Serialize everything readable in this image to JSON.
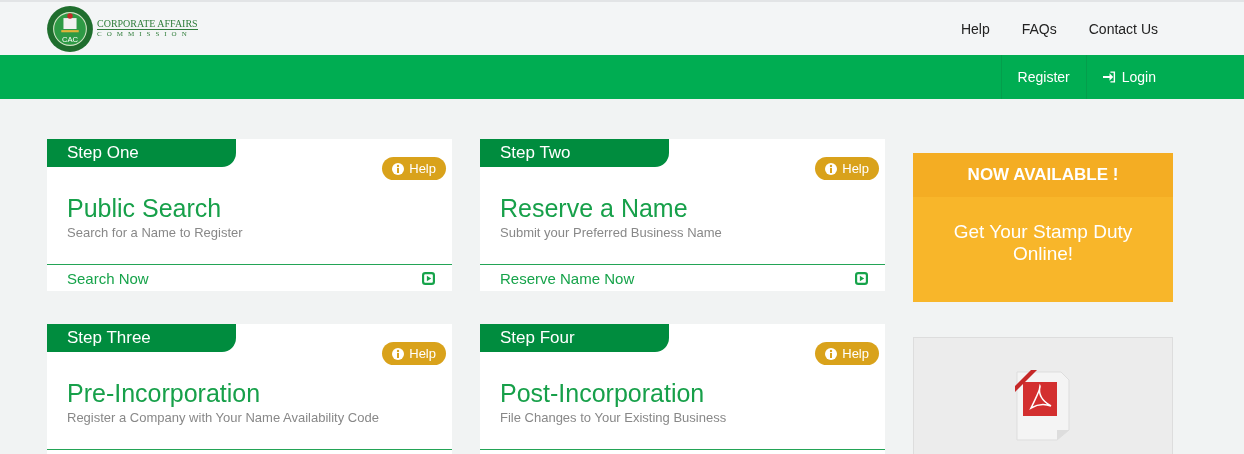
{
  "logo": {
    "seal_text": "CAC",
    "line_1": "CORPORATE AFFAIRS",
    "line_2": "COMMISSION"
  },
  "top_nav": [
    "Help",
    "FAQs",
    "Contact Us"
  ],
  "account_nav": [
    {
      "label": "Register",
      "kind": "plain"
    },
    {
      "label": "Login",
      "kind": "login"
    }
  ],
  "steps": [
    {
      "step": "Step One",
      "help": "Help",
      "title": "Public Search",
      "subtitle": "Search for a Name to Register",
      "link": "Search Now"
    },
    {
      "step": "Step Two",
      "help": "Help",
      "title": "Reserve a Name",
      "subtitle": "Submit your Preferred Business Name",
      "link": "Reserve Name Now"
    },
    {
      "step": "Step Three",
      "help": "Help",
      "title": "Pre-Incorporation",
      "subtitle": "Register a Company with Your Name Availability Code"
    },
    {
      "step": "Step Four",
      "help": "Help",
      "title": "Post-Incorporation",
      "subtitle": "File Changes to Your Existing Business"
    }
  ],
  "promo": {
    "heading": "NOW AVAILABLE !",
    "text": "Get Your Stamp Duty Online!"
  },
  "download": {
    "kind": "pdf"
  }
}
